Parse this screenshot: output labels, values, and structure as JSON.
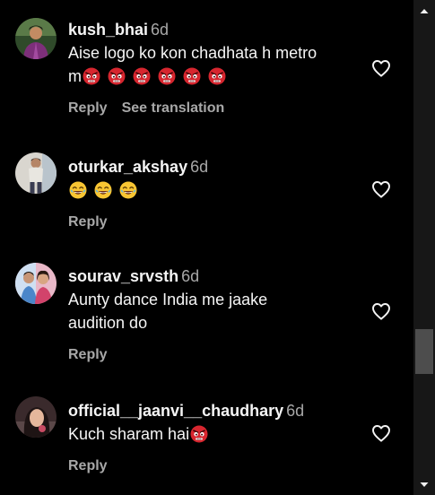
{
  "comments": [
    {
      "username": "kush_bhai",
      "time": "6d",
      "text_line1": "Aise logo ko kon chadhata h metro",
      "text_line2": "m",
      "emoji": "angry-face",
      "emoji_count": 6,
      "reply_label": "Reply",
      "translate_label": "See translation"
    },
    {
      "username": "oturkar_akshay",
      "time": "6d",
      "emoji": "laughing-face",
      "emoji_count": 3,
      "reply_label": "Reply"
    },
    {
      "username": "sourav_srvsth",
      "time": "6d",
      "text_line1": "Aunty dance India me jaake",
      "text_line2": "audition do",
      "reply_label": "Reply"
    },
    {
      "username": "official__jaanvi__chaudhary",
      "time": "6d",
      "text_line1": "Kuch sharam hai",
      "emoji": "angry-face",
      "emoji_count": 1,
      "reply_label": "Reply"
    }
  ],
  "colors": {
    "background": "#000000",
    "text": "#f5f5f5",
    "secondary_text": "#a8a8a8",
    "scrollbar_track": "#171717",
    "scrollbar_thumb": "#4d4d4d"
  }
}
